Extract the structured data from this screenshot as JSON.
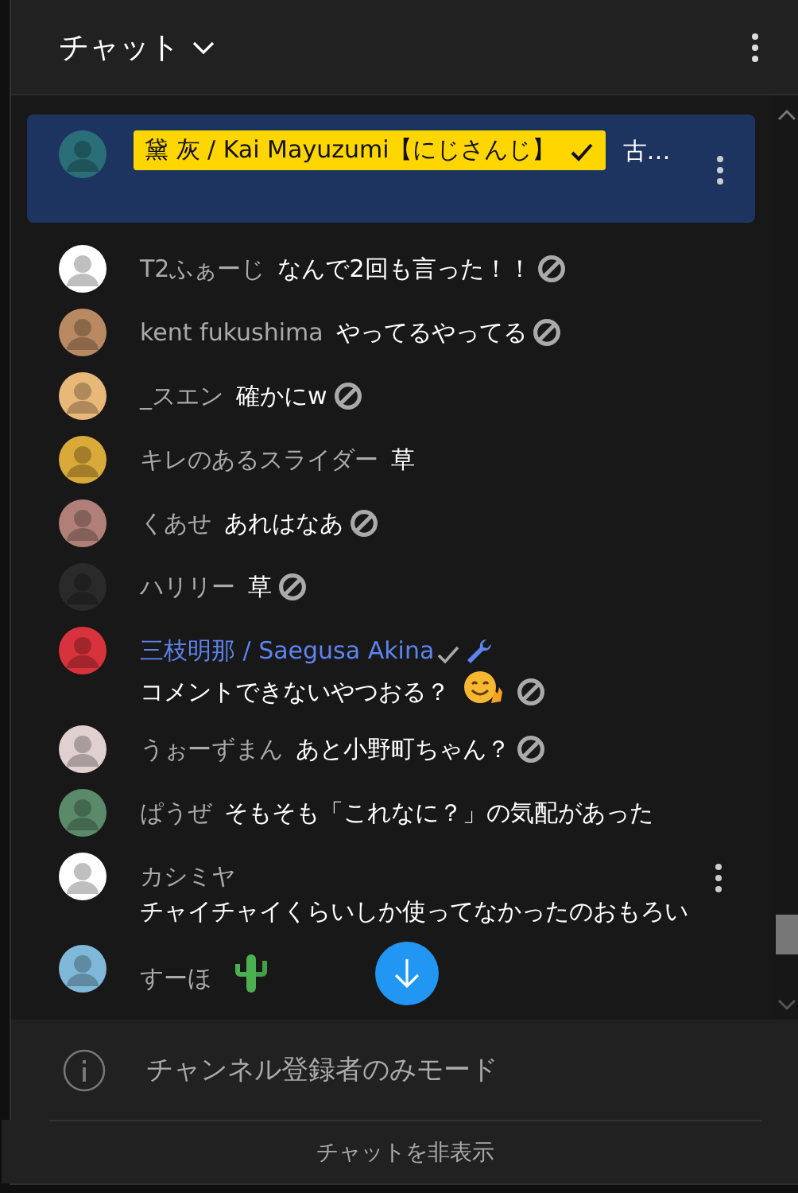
{
  "header": {
    "title": "チャット"
  },
  "pinned": {
    "author": "黛 灰 / Kai Mayuzumi【にじさんじ】",
    "verified": true,
    "message": "古…",
    "avatar": {
      "color": "#2a6f78"
    }
  },
  "messages": [
    {
      "author": "T2ふぁーじ",
      "message": "なんで2回も言った！！",
      "moderator": false,
      "removal_icon": true,
      "menu_visible": false,
      "avatar": {
        "color": "#ffffff"
      }
    },
    {
      "author": "kent fukushima",
      "message": "やってるやってる",
      "moderator": false,
      "removal_icon": true,
      "menu_visible": false,
      "avatar": {
        "color": "#b98a62"
      }
    },
    {
      "author": "_スエン",
      "message": "確かにw",
      "moderator": false,
      "removal_icon": true,
      "menu_visible": false,
      "avatar": {
        "color": "#e8b878"
      }
    },
    {
      "author": "キレのあるスライダー",
      "message": "草",
      "moderator": false,
      "removal_icon": false,
      "menu_visible": false,
      "avatar": {
        "color": "#d9a93a"
      }
    },
    {
      "author": "くあせ",
      "message": "あれはなあ",
      "moderator": false,
      "removal_icon": true,
      "menu_visible": false,
      "avatar": {
        "color": "#b08078"
      }
    },
    {
      "author": "ハリリー",
      "message": "草",
      "moderator": false,
      "removal_icon": true,
      "menu_visible": false,
      "avatar": {
        "color": "#2a2a2a"
      }
    },
    {
      "author": "三枝明那 / Saegusa Akina",
      "message": "コメントできないやつおる？",
      "emoji": {
        "kind": "smile"
      },
      "moderator": true,
      "removal_icon": true,
      "menu_visible": false,
      "avatar": {
        "color": "#d8323c"
      }
    },
    {
      "author": "うぉーずまん",
      "message": "あと小野町ちゃん？",
      "moderator": false,
      "removal_icon": true,
      "menu_visible": false,
      "avatar": {
        "color": "#e0d0d0"
      }
    },
    {
      "author": "ぱうぜ",
      "message": "そもそも「これなに？」の気配があった",
      "moderator": false,
      "removal_icon": false,
      "menu_visible": false,
      "avatar": {
        "color": "#5a8a6a"
      }
    },
    {
      "author": "カシミヤ",
      "message": "チャイチャイくらいしか使ってなかったのおもろい",
      "moderator": false,
      "removal_icon": false,
      "menu_visible": true,
      "avatar": {
        "color": "#ffffff"
      }
    },
    {
      "author": "すーほ",
      "emoji": {
        "kind": "cactus"
      },
      "moderator": false,
      "removal_icon": false,
      "menu_visible": false,
      "avatar": {
        "color": "#7fb8d8"
      }
    }
  ],
  "notice": {
    "text": "チャンネル登録者のみモード"
  },
  "footer": {
    "button": "チャットを非表示"
  }
}
